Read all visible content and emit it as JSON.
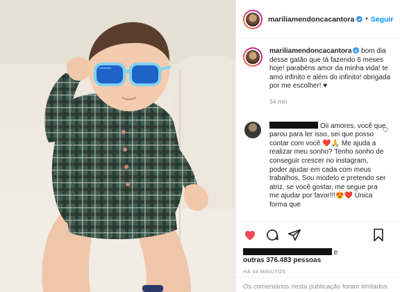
{
  "post": {
    "username": "mariliamendoncacantora",
    "follow_label": "Seguir",
    "dot": "•"
  },
  "caption": {
    "username": "mariliamendoncacantora",
    "text": " bom dia desse gatão que tá fazendo 6 meses hoje! parabéns amor da minha vida! te amo infinito e além do infinito! obrigada por me escolher! ♥",
    "time": "34 min"
  },
  "comment": {
    "text": "Oii amores, você que parou para ler isso, sei que posso contar com você ❤️🙏 Me ajuda a realizar meu sonho? Tenho sonho de conseguir crescer no instagram, poder ajudar em cada com meus trabalhos, Sou modelo e pretendo ser atriz, se você gostar, me segue pra me ajudar por favor!!!😍❤️ Única forma que"
  },
  "likes": {
    "suffix": "e",
    "others": "outras 376.483 pessoas"
  },
  "timestamp": "HÁ 34 MINUTOS",
  "comments_limited": "Os comentários nesta publicação foram limitados.",
  "icons": [
    "heart-icon",
    "comment-icon",
    "share-icon",
    "bookmark-icon",
    "small-heart-icon"
  ],
  "colors": {
    "accent": "#0095f6",
    "like_red": "#ed4956",
    "muted": "#8e8e8e"
  }
}
